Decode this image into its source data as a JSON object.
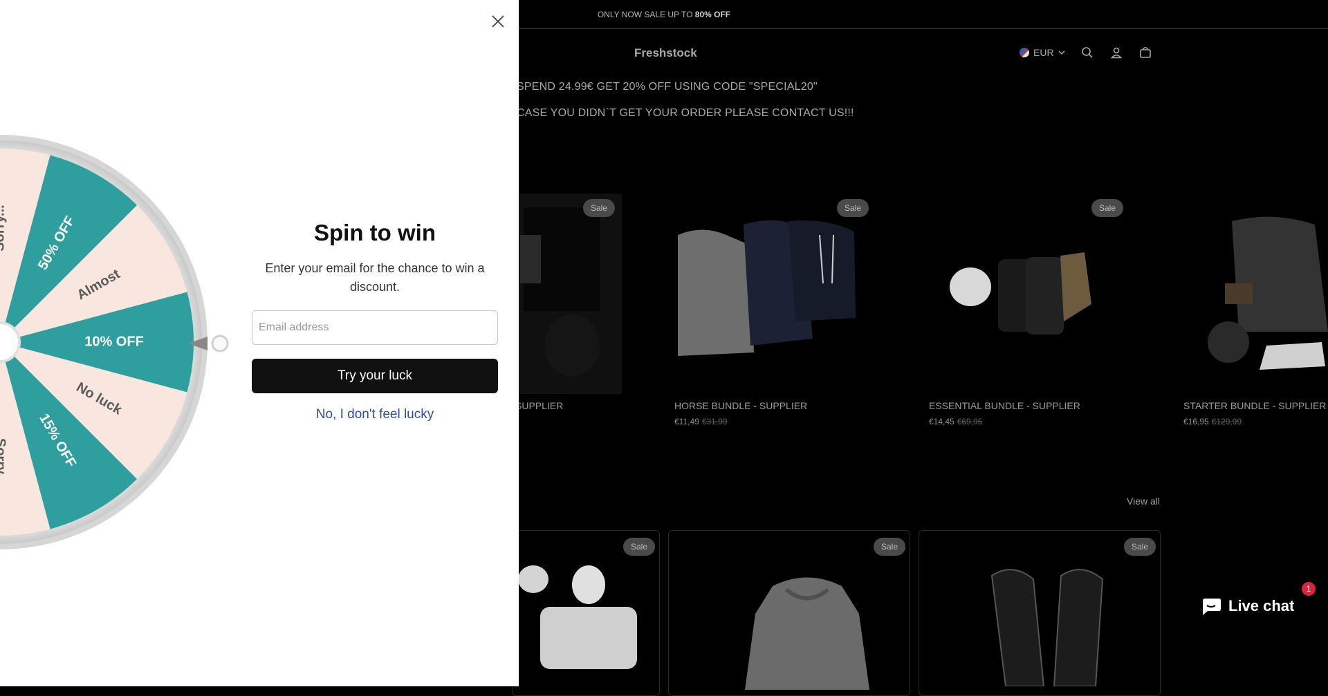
{
  "announcement": {
    "text": "ONLY NOW SALE UP TO ",
    "bold": "80% OFF"
  },
  "header": {
    "logo": "Freshstock",
    "currency": "EUR",
    "icons": [
      "search-icon",
      "account-icon",
      "cart-icon"
    ]
  },
  "promos": [
    "SPEND 24.99€ GET 20% OFF USING CODE \"SPECIAL20\"",
    "CASE YOU DIDN`T GET YOUR ORDER PLEASE CONTACT US!!!"
  ],
  "products": [
    {
      "title": "SUPPLIER",
      "badge": "Sale"
    },
    {
      "title": "HORSE BUNDLE - SUPPLIER",
      "price": "€11,49",
      "compare": "€31,99",
      "badge": "Sale"
    },
    {
      "title": "ESSENTIAL BUNDLE - SUPPLIER",
      "price": "€14,45",
      "compare": "€69,95",
      "badge": "Sale"
    },
    {
      "title": "STARTER BUNDLE - SUPPLIER",
      "price": "€16,95",
      "compare": "€129,99"
    }
  ],
  "section2": {
    "view_all": "View all",
    "badges": [
      "Sale",
      "Sale",
      "Sale"
    ]
  },
  "livechat": {
    "label": "Live chat",
    "count": "1"
  },
  "modal": {
    "title": "Spin to win",
    "subtitle": "Enter your email for the chance to win a discount.",
    "email_placeholder": "Email address",
    "try_button": "Try your luck",
    "decline": "No, I don't feel lucky",
    "wheel_segments": [
      "50% OFF",
      "Almost",
      "10% OFF",
      "No luck",
      "15% OFF",
      "Sorry",
      "Sorry..."
    ],
    "colors": {
      "teal": "#2e9e9e",
      "cream": "#f8e6df",
      "button": "#111111",
      "link": "#2f4d9c"
    }
  }
}
